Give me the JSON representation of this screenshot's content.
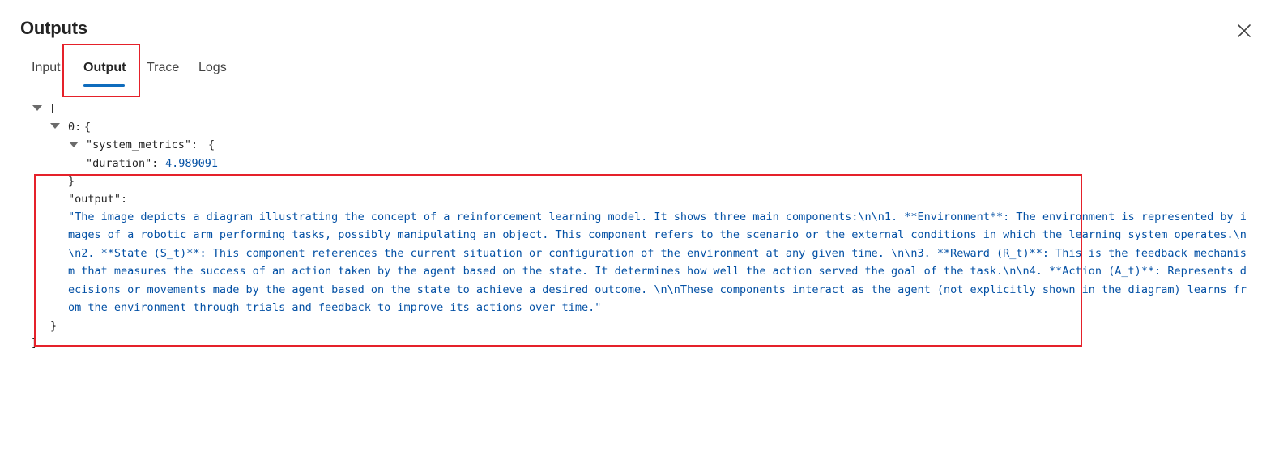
{
  "panel": {
    "title": "Outputs",
    "close_icon": "close-icon"
  },
  "tabs": [
    {
      "label": "Input",
      "active": false
    },
    {
      "label": "Output",
      "active": true
    },
    {
      "label": "Trace",
      "active": false
    },
    {
      "label": "Logs",
      "active": false
    }
  ],
  "json_view": {
    "root_open": "[",
    "item_key": "0:",
    "item_open": "{",
    "system_metrics_key": "\"system_metrics\":",
    "system_metrics_open": "{",
    "duration_key": "\"duration\":",
    "duration_value": "4.989091",
    "system_metrics_close": "}",
    "output_key": "\"output\":",
    "output_value": "\"The image depicts a diagram illustrating the concept of a reinforcement learning model. It shows three main components:\\n\\n1. **Environment**: The environment is represented by images of a robotic arm performing tasks, possibly manipulating an object. This component refers to the scenario or the external conditions in which the learning system operates.\\n\\n2. **State (S_t)**: This component references the current situation or configuration of the environment at any given time. \\n\\n3. **Reward (R_t)**: This is the feedback mechanism that measures the success of an action taken by the agent based on the state. It determines how well the action served the goal of the task.\\n\\n4. **Action (A_t)**: Represents decisions or movements made by the agent based on the state to achieve a desired outcome. \\n\\nThese components interact as the agent (not explicitly shown in the diagram) learns from the environment through trials and feedback to improve its actions over time.\"",
    "item_close": "}",
    "root_close": "]"
  },
  "colors": {
    "accent": "#0f6cbd",
    "highlight": "#e5212a",
    "json_value": "#0451a5"
  }
}
